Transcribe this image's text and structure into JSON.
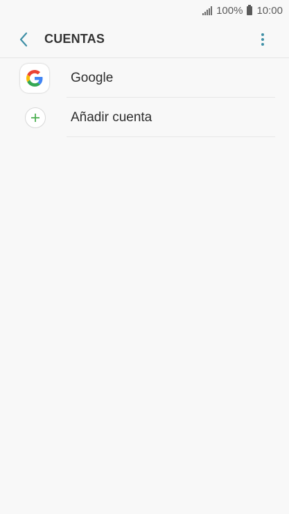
{
  "status_bar": {
    "battery_text": "100%",
    "time": "10:00"
  },
  "header": {
    "title": "CUENTAS",
    "back_icon": "chevron-left-icon",
    "more_icon": "more-vertical-icon",
    "accent_color": "#3e8fa6"
  },
  "accounts": {
    "items": [
      {
        "label": "Google",
        "icon": "google-logo-icon"
      },
      {
        "label": "Añadir cuenta",
        "icon": "plus-icon",
        "icon_color": "#4caf50"
      }
    ]
  }
}
